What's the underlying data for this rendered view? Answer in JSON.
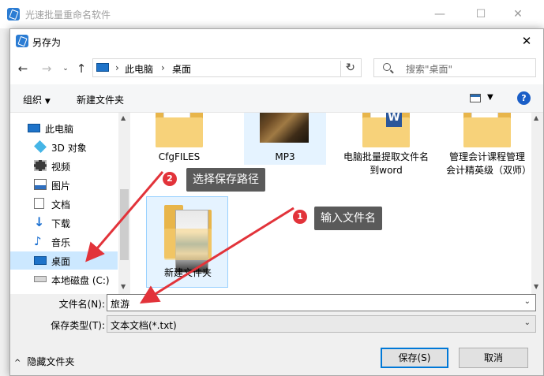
{
  "background_window": {
    "title": "光速批量重命名软件"
  },
  "dialog": {
    "title": "另存为",
    "nav": {
      "breadcrumb": [
        "此电脑",
        "桌面"
      ],
      "search_placeholder": "搜索\"桌面\""
    },
    "toolbar": {
      "organize": "组织",
      "new_folder": "新建文件夹"
    },
    "sidebar": {
      "items": [
        {
          "label": "此电脑",
          "icon": "pc-icon"
        },
        {
          "label": "3D 对象",
          "icon": "cube-icon"
        },
        {
          "label": "视频",
          "icon": "video-icon"
        },
        {
          "label": "图片",
          "icon": "picture-icon"
        },
        {
          "label": "文档",
          "icon": "document-icon"
        },
        {
          "label": "下载",
          "icon": "download-icon"
        },
        {
          "label": "音乐",
          "icon": "music-icon"
        },
        {
          "label": "桌面",
          "icon": "desktop-icon"
        },
        {
          "label": "本地磁盘 (C:)",
          "icon": "drive-icon"
        }
      ]
    },
    "files": [
      {
        "name": "CfgFILES",
        "type": "folder"
      },
      {
        "name": "MP3",
        "type": "folder-photo"
      },
      {
        "name": "电脑批量提取文件名到word",
        "type": "word-folder"
      },
      {
        "name": "管理会计课程管理会计精英级（双师）",
        "type": "folder"
      },
      {
        "name": "新建文件夹",
        "type": "folder-doc"
      }
    ],
    "filename": {
      "label": "文件名(N):",
      "value": "旅游"
    },
    "filetype": {
      "label": "保存类型(T):",
      "value": "文本文档(*.txt)"
    },
    "hide_folders": "隐藏文件夹",
    "save": "保存(S)",
    "cancel": "取消"
  },
  "annotations": [
    {
      "number": "2",
      "text": "选择保存路径"
    },
    {
      "number": "1",
      "text": "输入文件名"
    }
  ],
  "colors": {
    "accent": "#0078d7",
    "selection": "#cce8ff",
    "annotation_red": "#e2333a",
    "callout_bg": "#5a5a5a"
  }
}
